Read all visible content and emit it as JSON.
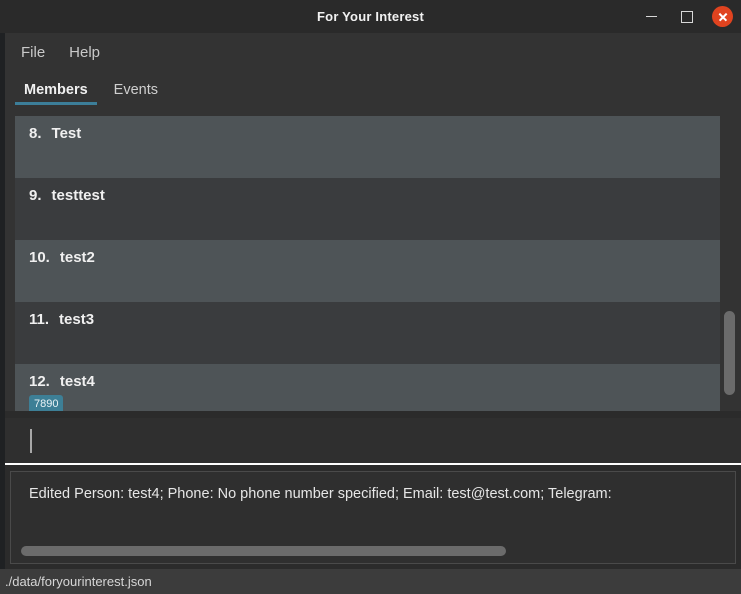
{
  "window": {
    "title": "For Your Interest",
    "controls": {
      "minimize": "minimize",
      "maximize": "maximize",
      "close": "close"
    }
  },
  "menubar": {
    "items": [
      {
        "label": "File"
      },
      {
        "label": "Help"
      }
    ]
  },
  "tabs": [
    {
      "label": "Members",
      "active": true
    },
    {
      "label": "Events",
      "active": false
    }
  ],
  "member_list": {
    "rows": [
      {
        "index": "8.",
        "name": "Test",
        "tags": []
      },
      {
        "index": "9.",
        "name": "testtest",
        "tags": []
      },
      {
        "index": "10.",
        "name": "test2",
        "tags": []
      },
      {
        "index": "11.",
        "name": "test3",
        "tags": []
      },
      {
        "index": "12.",
        "name": "test4",
        "tags": [
          "7890"
        ]
      }
    ]
  },
  "command": {
    "value": "",
    "placeholder": ""
  },
  "result": {
    "text": "Edited Person: test4; Phone: No phone number specified; Email: test@test.com; Telegram:"
  },
  "statusbar": {
    "path": "./data/foryourinterest.json"
  },
  "colors": {
    "accent": "#3c7e99",
    "tag_bg": "#3d7f96",
    "close_btn": "#e0431f",
    "row_odd": "#4e5457",
    "row_even": "#3a3c3e",
    "panel_bg": "#333333",
    "window_bg": "#2b2b2b"
  }
}
